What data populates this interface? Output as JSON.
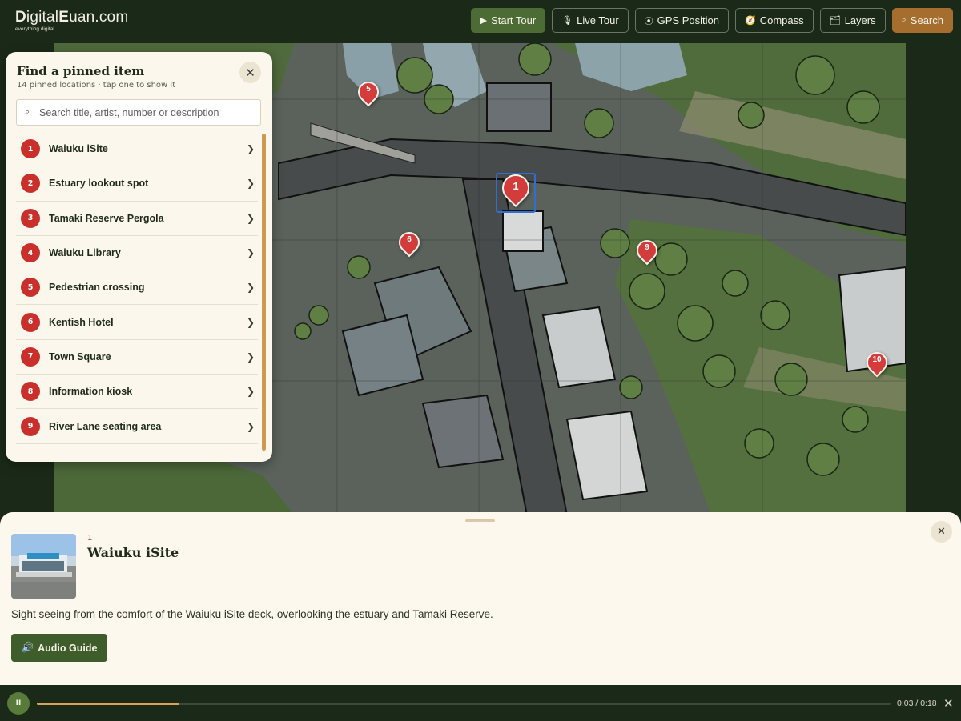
{
  "header": {
    "logo": {
      "d": "D",
      "igital": "igital",
      "e": "E",
      "uan": "uan.com",
      "tagline": "everything digital"
    },
    "nav": [
      {
        "id": "start-tour",
        "icon": "▶",
        "label": "Start Tour"
      },
      {
        "id": "live-tour",
        "icon": "🎙",
        "label": "Live Tour"
      },
      {
        "id": "gps",
        "icon": "⦿",
        "label": "GPS Position"
      },
      {
        "id": "compass",
        "icon": "🧭",
        "label": "Compass"
      },
      {
        "id": "layers",
        "icon": "🗂",
        "label": "Layers"
      },
      {
        "id": "search",
        "icon": "⌕",
        "label": "Search"
      }
    ]
  },
  "panel": {
    "title": "Find a pinned item",
    "subtitle": "14 pinned locations · tap one to show it",
    "search_placeholder": "Search title, artist, number or description",
    "items": [
      {
        "num": "1",
        "label": "Waiuku iSite"
      },
      {
        "num": "2",
        "label": "Estuary lookout spot"
      },
      {
        "num": "3",
        "label": "Tamaki Reserve Pergola"
      },
      {
        "num": "4",
        "label": "Waiuku Library"
      },
      {
        "num": "5",
        "label": "Pedestrian crossing"
      },
      {
        "num": "6",
        "label": "Kentish Hotel"
      },
      {
        "num": "7",
        "label": "Town Square"
      },
      {
        "num": "8",
        "label": "Information kiosk"
      },
      {
        "num": "9",
        "label": "River Lane seating area"
      }
    ]
  },
  "map": {
    "pins": [
      {
        "num": "5"
      },
      {
        "num": "1"
      },
      {
        "num": "6"
      },
      {
        "num": "9"
      },
      {
        "num": "10"
      }
    ]
  },
  "detail": {
    "number": "1",
    "title": "Waiuku iSite",
    "description": "Sight seeing from the comfort of the Waiuku iSite deck, overlooking the estuary and Tamaki Reserve.",
    "audio_label": "Audio Guide",
    "audio_icon": "🔊"
  },
  "player": {
    "play_icon": "II",
    "progress": 0.167,
    "time": "0:03 / 0:18"
  }
}
